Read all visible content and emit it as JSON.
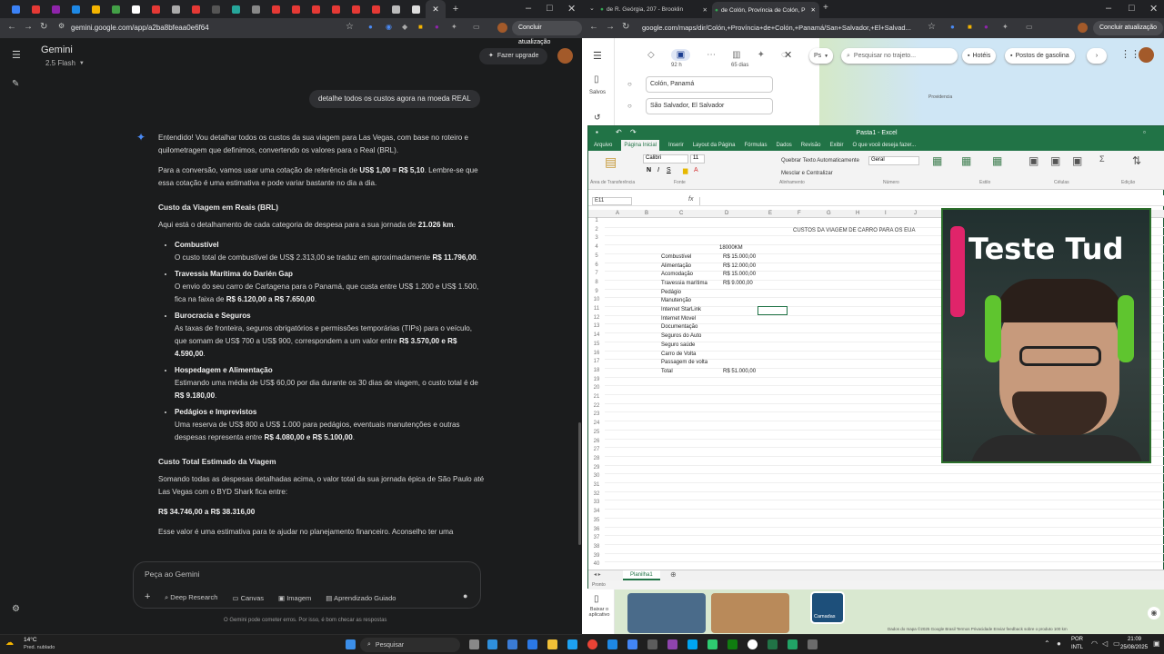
{
  "left_browser": {
    "url": "gemini.google.com/app/a2ba8bfeaa0e6f64",
    "update_label": "Concluir atualização",
    "window_controls": [
      "–",
      "□",
      "✕"
    ]
  },
  "gemini": {
    "title": "Gemini",
    "model": "2.5 Flash",
    "upgrade_label": "Fazer upgrade",
    "user_message": "detalhe todos os custos agora na moeda REAL",
    "intro": "Entendido! Vou detalhar todos os custos da sua viagem para Las Vegas, com base no roteiro e quilometragem que definimos, convertendo os valores para o Real (BRL).",
    "rate_pre": "Para a conversão, vamos usar uma cotação de referência de ",
    "rate_bold": "US$ 1,00 = R$ 5,10",
    "rate_post": ". Lembre-se que essa cotação é uma estimativa e pode variar bastante no dia a dia.",
    "section1_title": "Custo da Viagem em Reais (BRL)",
    "section1_intro_pre": "Aqui está o detalhamento de cada categoria de despesa para a sua jornada de ",
    "section1_intro_bold": "21.026 km",
    "section1_intro_post": ".",
    "items": [
      {
        "title": "Combustível",
        "pre": "O custo total de combustível de US$ 2.313,00 se traduz em aproximadamente ",
        "bold": "R$ 11.796,00",
        "post": "."
      },
      {
        "title": "Travessia Marítima do Darién Gap",
        "pre": "O envio do seu carro de Cartagena para o Panamá, que custa entre US$ 1.200 e US$ 1.500, fica na faixa de ",
        "bold": "R$ 6.120,00 a R$ 7.650,00",
        "post": "."
      },
      {
        "title": "Burocracia e Seguros",
        "pre": "As taxas de fronteira, seguros obrigatórios e permissões temporárias (TIPs) para o veículo, que somam de US$ 700 a US$ 900, correspondem a um valor entre ",
        "bold": "R$ 3.570,00 e R$ 4.590,00",
        "post": "."
      },
      {
        "title": "Hospedagem e Alimentação",
        "pre": "Estimando uma média de US$ 60,00 por dia durante os 30 dias de viagem, o custo total é de ",
        "bold": "R$ 9.180,00",
        "post": "."
      },
      {
        "title": "Pedágios e Imprevistos",
        "pre": "Uma reserva de US$ 800 a US$ 1.000 para pedágios, eventuais manutenções e outras despesas representa entre ",
        "bold": "R$ 4.080,00 e R$ 5.100,00",
        "post": "."
      }
    ],
    "section2_title": "Custo Total Estimado da Viagem",
    "section2_text": "Somando todas as despesas detalhadas acima, o valor total da sua jornada épica de São Paulo até Las Vegas com o BYD Shark fica entre:",
    "total_range": "R$ 34.746,00 a R$ 38.316,00",
    "closing": "Esse valor é uma estimativa para te ajudar no planejamento financeiro. Aconselho ter uma",
    "input_placeholder": "Peça ao Gemini",
    "tools": [
      "Deep Research",
      "Canvas",
      "Imagem",
      "Aprendizado Guiado"
    ],
    "footer": "O Gemini pode cometer erros. Por isso, é bom checar as respostas"
  },
  "right_browser": {
    "tab1": "de R. Geórgia, 207 - Brooklin",
    "tab2": "de Colón, Província de Colón, P",
    "url": "google.com/maps/dir/Colón,+Província+de+Colón,+Panamá/San+Salvador,+El+Salvad...",
    "update_label": "Concluir atualização",
    "durations": [
      "92 h",
      "65 dias"
    ],
    "origin": "Colón, Panamá",
    "destination": "São Salvador, El Salvador",
    "search_placeholder": "Pesquisar no trajeto...",
    "chips": [
      "Hotéis",
      "Postos de gasolina"
    ],
    "saved_label": "Salvos",
    "map_place": "Providencia",
    "map_layers": "Camadas",
    "download_label": "Baixar o aplicativo",
    "map_footer": "Dados do mapa ©2025 Google   Brasil   Termos   Privacidade   Enviar feedback sobre o produto   100 km"
  },
  "excel": {
    "title": "Pasta1 - Excel",
    "tabs": [
      "Arquivo",
      "Página Inicial",
      "Inserir",
      "Layout da Página",
      "Fórmulas",
      "Dados",
      "Revisão",
      "Exibir",
      "O que você deseja fazer..."
    ],
    "font": "Calibri",
    "font_size": "11",
    "wrap": "Quebrar Texto Automaticamente",
    "merge": "Mesclar e Centralizar",
    "number_format": "Geral",
    "ribbon_groups": [
      "Área de Transferência",
      "Fonte",
      "Alinhamento",
      "Número",
      "Estilo",
      "Células",
      "Edição"
    ],
    "name_box": "E11",
    "columns": [
      "A",
      "B",
      "C",
      "D",
      "E",
      "F",
      "G",
      "H",
      "I",
      "J"
    ],
    "sheet_title": "CUSTOS DA VIAGEM DE CARRO PARA OS EUA",
    "km": "18000KM",
    "rows": [
      {
        "r": 5,
        "label": "Combustível",
        "value": "R$ 15.000,00"
      },
      {
        "r": 6,
        "label": "Alimentação",
        "value": "R$ 12.000,00"
      },
      {
        "r": 7,
        "label": "Acomodação",
        "value": "R$ 15.000,00"
      },
      {
        "r": 8,
        "label": "Travessia marítima",
        "value": "R$ 9.000,00"
      },
      {
        "r": 9,
        "label": "Pedágio",
        "value": ""
      },
      {
        "r": 10,
        "label": "Manutenção",
        "value": ""
      },
      {
        "r": 11,
        "label": "Internet StarLink",
        "value": ""
      },
      {
        "r": 12,
        "label": "Internet Movel",
        "value": ""
      },
      {
        "r": 13,
        "label": "Documentação",
        "value": ""
      },
      {
        "r": 14,
        "label": "Seguros do Auto",
        "value": ""
      },
      {
        "r": 15,
        "label": "Seguro saúde",
        "value": ""
      },
      {
        "r": 16,
        "label": "Carro de Volta",
        "value": ""
      },
      {
        "r": 17,
        "label": "Passagem de volta",
        "value": ""
      },
      {
        "r": 18,
        "label": "Total",
        "value": "R$ 51.000,00"
      }
    ],
    "sheet_tab": "Planilha1",
    "status": "Pronto"
  },
  "webcam": {
    "overlay_text": "Teste Tud"
  },
  "taskbar": {
    "weather_temp": "14°C",
    "weather_desc": "Pred. nublado",
    "search_label": "Pesquisar",
    "lang1": "POR",
    "lang2": "INTL",
    "time": "21:09",
    "date": "25/08/2025"
  },
  "colors": {
    "excel_green": "#217346",
    "gemini_bg": "#1b1c1d",
    "accent_blue": "#4a8af4"
  }
}
